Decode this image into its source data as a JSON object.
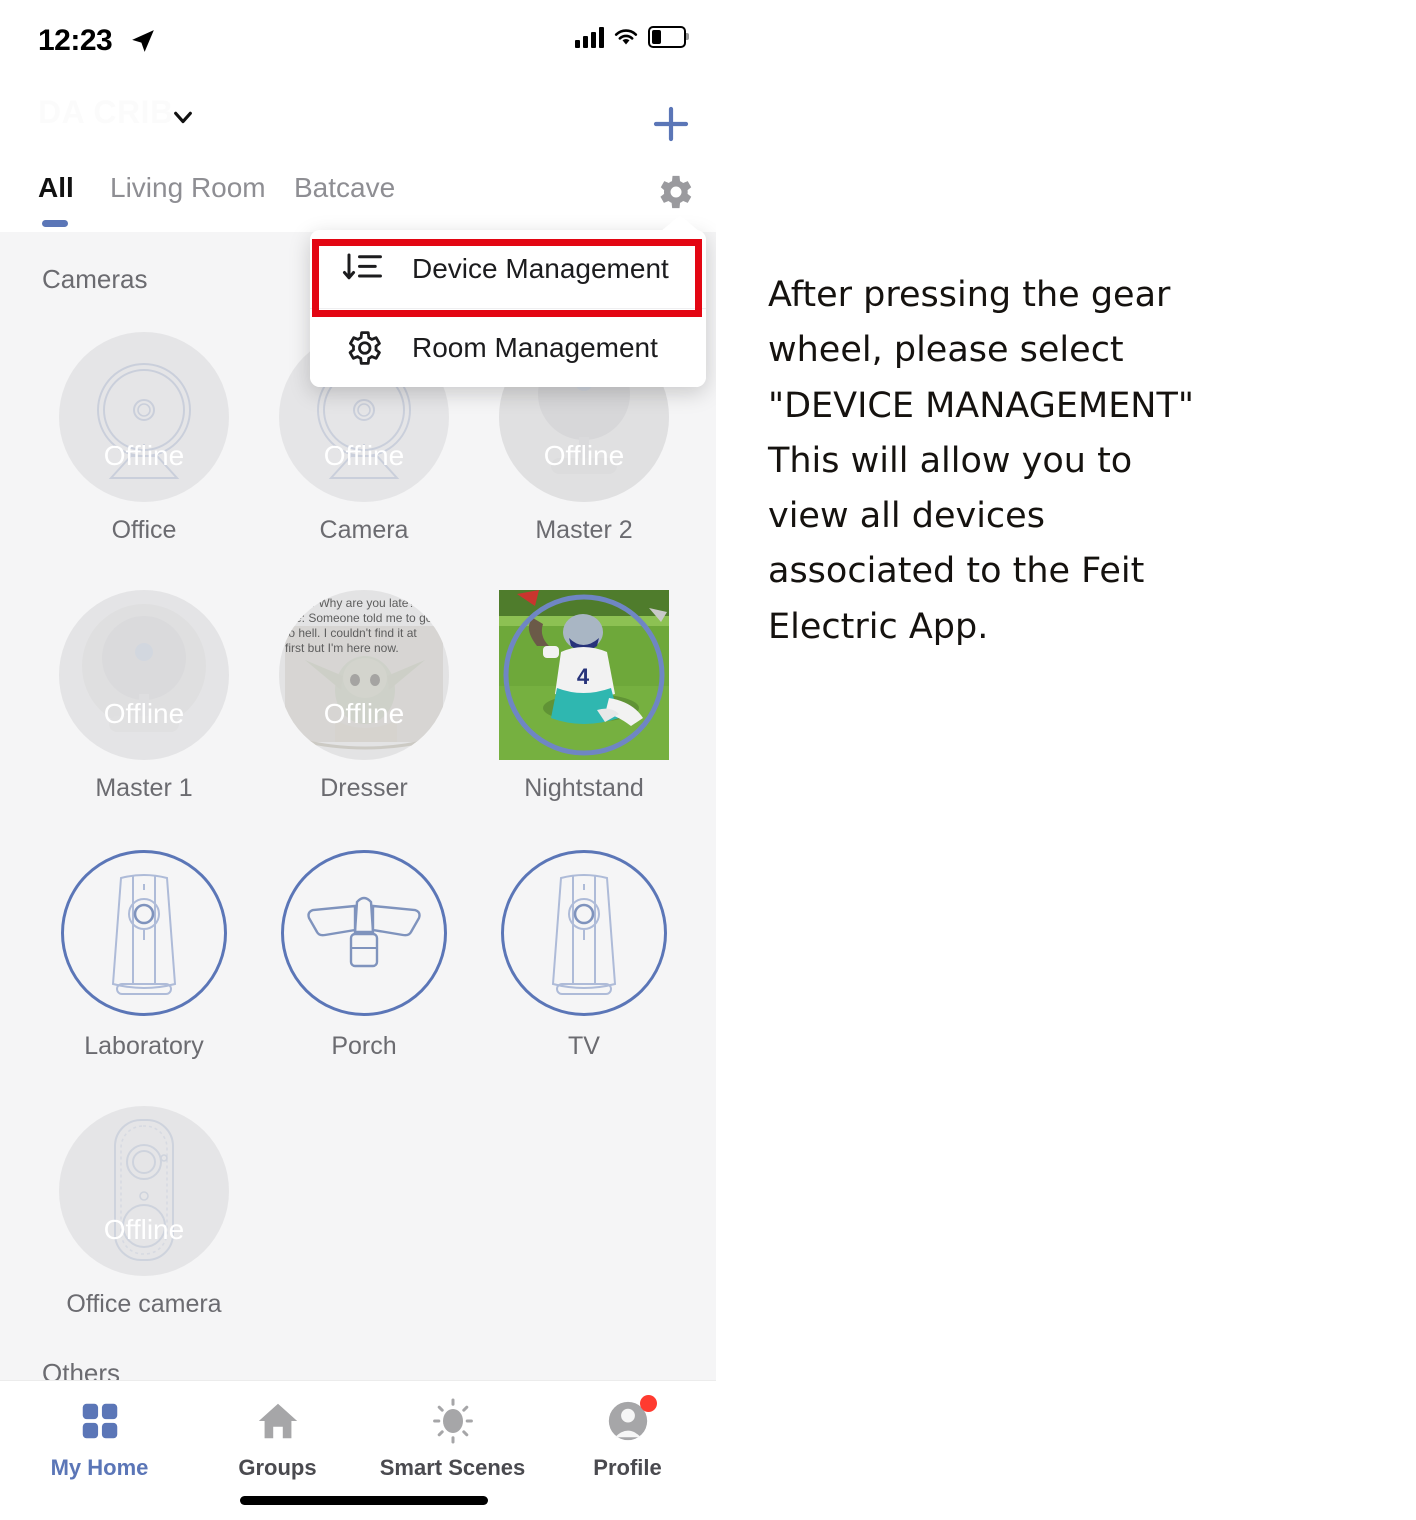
{
  "status_bar": {
    "time": "12:23",
    "location_icon": "location-arrow-icon",
    "signal_icon": "cellular-signal-icon",
    "wifi_icon": "wifi-icon",
    "battery_icon": "battery-low-icon"
  },
  "header": {
    "home_name": "DA CRIB",
    "home_name_color": "#fbfbfb",
    "chevron_icon": "chevron-down-icon",
    "add_icon": "plus-icon",
    "add_icon_color": "#5b76b7"
  },
  "tabs": {
    "items": [
      {
        "label": "All",
        "active": true
      },
      {
        "label": "Living Room",
        "active": false
      },
      {
        "label": "Batcave",
        "active": false
      }
    ],
    "settings_icon": "gear-icon",
    "active_underline_color": "#5b76b7"
  },
  "dropdown": {
    "visible": true,
    "highlight_color": "#e30613",
    "items": [
      {
        "label": "Device Management",
        "icon": "sort-list-icon",
        "highlighted": true
      },
      {
        "label": "Room Management",
        "icon": "gear-icon",
        "highlighted": false
      }
    ]
  },
  "sections": [
    {
      "title": "Cameras"
    },
    {
      "title": "Others"
    }
  ],
  "devices": [
    {
      "name": "Office",
      "status": "Offline",
      "online": false,
      "art": "dome-camera"
    },
    {
      "name": "Camera",
      "status": "Offline",
      "online": false,
      "art": "dome-camera"
    },
    {
      "name": "Master 2",
      "status": "Offline",
      "online": false,
      "art": "photo-dark"
    },
    {
      "name": "Master 1",
      "status": "Offline",
      "online": false,
      "art": "photo-camera"
    },
    {
      "name": "Dresser",
      "status": "Offline",
      "online": false,
      "art": "photo-meme",
      "thumbnail_text": "Boss: Why are you late? Me: Someone told me to go to hell. I couldn't find it at first but I'm here now."
    },
    {
      "name": "Nightstand",
      "status": "",
      "online": true,
      "art": "photo-football"
    },
    {
      "name": "Laboratory",
      "status": "",
      "online": true,
      "art": "tower-camera"
    },
    {
      "name": "Porch",
      "status": "",
      "online": true,
      "art": "floodlight"
    },
    {
      "name": "TV",
      "status": "",
      "online": true,
      "art": "tower-camera"
    },
    {
      "name": "Office camera",
      "status": "Offline",
      "online": false,
      "art": "doorbell-camera"
    }
  ],
  "bottom_nav": {
    "items": [
      {
        "label": "My Home",
        "icon": "grid-squares-icon",
        "active": true,
        "badge": false
      },
      {
        "label": "Groups",
        "icon": "house-icon",
        "active": false,
        "badge": false
      },
      {
        "label": "Smart Scenes",
        "icon": "sun-icon",
        "active": false,
        "badge": false
      },
      {
        "label": "Profile",
        "icon": "person-icon",
        "active": false,
        "badge": true
      }
    ],
    "active_color": "#5b76b7",
    "badge_color": "#ff3b30"
  },
  "annotation": {
    "text": "After pressing the gear wheel, please select \"DEVICE MANAGEMENT\" This will allow you to view all devices associated to the Feit Electric App."
  }
}
